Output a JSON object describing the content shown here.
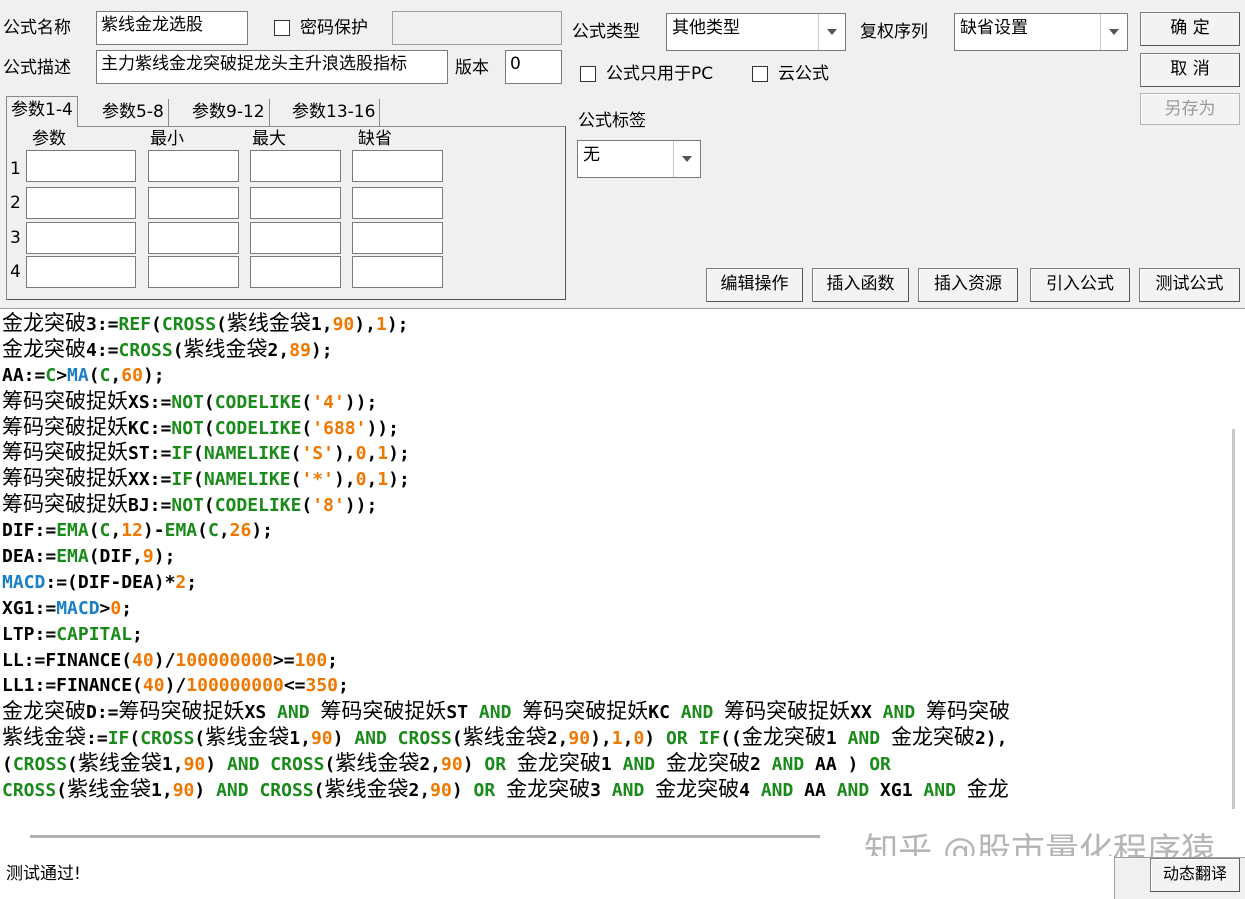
{
  "form": {
    "name_label": "公式名称",
    "name_value": "紫线金龙选股",
    "password_label": "密码保护",
    "desc_label": "公式描述",
    "desc_value": "主力紫线金龙突破捉龙头主升浪选股指标",
    "version_label": "版本",
    "version_value": "0",
    "type_label": "公式类型",
    "type_value": "其他类型",
    "rights_label": "复权序列",
    "rights_value": "缺省设置",
    "pc_only_label": "公式只用于PC",
    "cloud_label": "云公式",
    "tag_label": "公式标签",
    "tag_value": "无"
  },
  "buttons": {
    "ok": "确  定",
    "cancel": "取  消",
    "save_as": "另存为",
    "edit_ops": "编辑操作",
    "insert_func": "插入函数",
    "insert_res": "插入资源",
    "import_formula": "引入公式",
    "test_formula": "测试公式",
    "dynamic_translate": "动态翻译"
  },
  "tabs": [
    "参数1-4",
    "参数5-8",
    "参数9-12",
    "参数13-16"
  ],
  "params": {
    "headers": [
      "参数",
      "最小",
      "最大",
      "缺省"
    ],
    "rows": [
      "1",
      "2",
      "3",
      "4"
    ]
  },
  "code_lines": [
    [
      [
        "cn",
        "金龙突破"
      ],
      [
        "t",
        "3:="
      ],
      [
        "kw",
        "REF"
      ],
      [
        "t",
        "("
      ],
      [
        "kw",
        "CROSS"
      ],
      [
        "t",
        "("
      ],
      [
        "cn",
        "紫线金袋"
      ],
      [
        "t",
        "1,"
      ],
      [
        "num",
        "90"
      ],
      [
        "t",
        "),"
      ],
      [
        "num",
        "1"
      ],
      [
        "t",
        ");"
      ]
    ],
    [
      [
        "cn",
        "金龙突破"
      ],
      [
        "t",
        "4:="
      ],
      [
        "kw",
        "CROSS"
      ],
      [
        "t",
        "("
      ],
      [
        "cn",
        "紫线金袋"
      ],
      [
        "t",
        "2,"
      ],
      [
        "num",
        "89"
      ],
      [
        "t",
        ");"
      ]
    ],
    [
      [
        "t",
        "AA:="
      ],
      [
        "kw",
        "C"
      ],
      [
        "t",
        ">"
      ],
      [
        "id",
        "MA"
      ],
      [
        "t",
        "("
      ],
      [
        "kw",
        "C"
      ],
      [
        "t",
        ","
      ],
      [
        "num",
        "60"
      ],
      [
        "t",
        ");"
      ]
    ],
    [
      [
        "cn",
        "筹码突破捉妖"
      ],
      [
        "t",
        "XS:="
      ],
      [
        "kw",
        "NOT"
      ],
      [
        "t",
        "("
      ],
      [
        "kw",
        "CODELIKE"
      ],
      [
        "t",
        "("
      ],
      [
        "str",
        "'4'"
      ],
      [
        "t",
        "));"
      ]
    ],
    [
      [
        "cn",
        "筹码突破捉妖"
      ],
      [
        "t",
        "KC:="
      ],
      [
        "kw",
        "NOT"
      ],
      [
        "t",
        "("
      ],
      [
        "kw",
        "CODELIKE"
      ],
      [
        "t",
        "("
      ],
      [
        "str",
        "'688'"
      ],
      [
        "t",
        "));"
      ]
    ],
    [
      [
        "cn",
        "筹码突破捉妖"
      ],
      [
        "t",
        "ST:="
      ],
      [
        "kw",
        "IF"
      ],
      [
        "t",
        "("
      ],
      [
        "kw",
        "NAMELIKE"
      ],
      [
        "t",
        "("
      ],
      [
        "str",
        "'S'"
      ],
      [
        "t",
        "),"
      ],
      [
        "num",
        "0"
      ],
      [
        "t",
        ","
      ],
      [
        "num",
        "1"
      ],
      [
        "t",
        ");"
      ]
    ],
    [
      [
        "cn",
        "筹码突破捉妖"
      ],
      [
        "t",
        "XX:="
      ],
      [
        "kw",
        "IF"
      ],
      [
        "t",
        "("
      ],
      [
        "kw",
        "NAMELIKE"
      ],
      [
        "t",
        "("
      ],
      [
        "str",
        "'*'"
      ],
      [
        "t",
        "),"
      ],
      [
        "num",
        "0"
      ],
      [
        "t",
        ","
      ],
      [
        "num",
        "1"
      ],
      [
        "t",
        ");"
      ]
    ],
    [
      [
        "cn",
        "筹码突破捉妖"
      ],
      [
        "t",
        "BJ:="
      ],
      [
        "kw",
        "NOT"
      ],
      [
        "t",
        "("
      ],
      [
        "kw",
        "CODELIKE"
      ],
      [
        "t",
        "("
      ],
      [
        "str",
        "'8'"
      ],
      [
        "t",
        "));"
      ]
    ],
    [
      [
        "t",
        "DIF:="
      ],
      [
        "kw",
        "EMA"
      ],
      [
        "t",
        "("
      ],
      [
        "kw",
        "C"
      ],
      [
        "t",
        ","
      ],
      [
        "num",
        "12"
      ],
      [
        "t",
        ")-"
      ],
      [
        "kw",
        "EMA"
      ],
      [
        "t",
        "("
      ],
      [
        "kw",
        "C"
      ],
      [
        "t",
        ","
      ],
      [
        "num",
        "26"
      ],
      [
        "t",
        ");"
      ]
    ],
    [
      [
        "t",
        "DEA:="
      ],
      [
        "kw",
        "EMA"
      ],
      [
        "t",
        "(DIF,"
      ],
      [
        "num",
        "9"
      ],
      [
        "t",
        ");"
      ]
    ],
    [
      [
        "id",
        "MACD"
      ],
      [
        "t",
        ":=(DIF-DEA)*"
      ],
      [
        "num",
        "2"
      ],
      [
        "t",
        ";"
      ]
    ],
    [
      [
        "t",
        "XG1:="
      ],
      [
        "id",
        "MACD"
      ],
      [
        "t",
        ">"
      ],
      [
        "num",
        "0"
      ],
      [
        "t",
        ";"
      ]
    ],
    [
      [
        "t",
        "LTP:="
      ],
      [
        "kw",
        "CAPITAL"
      ],
      [
        "t",
        ";"
      ]
    ],
    [
      [
        "t",
        "LL:=FINANCE("
      ],
      [
        "num",
        "40"
      ],
      [
        "t",
        ")/"
      ],
      [
        "num",
        "100000000"
      ],
      [
        "t",
        ">="
      ],
      [
        "num",
        "100"
      ],
      [
        "t",
        ";"
      ]
    ],
    [
      [
        "t",
        "LL1:=FINANCE("
      ],
      [
        "num",
        "40"
      ],
      [
        "t",
        ")/"
      ],
      [
        "num",
        "100000000"
      ],
      [
        "t",
        "<="
      ],
      [
        "num",
        "350"
      ],
      [
        "t",
        ";"
      ]
    ],
    [
      [
        "cn",
        "金龙突破"
      ],
      [
        "t",
        "D:="
      ],
      [
        "cn",
        "筹码突破捉妖"
      ],
      [
        "t",
        "XS "
      ],
      [
        "kw",
        "AND"
      ],
      [
        "t",
        " "
      ],
      [
        "cn",
        "筹码突破捉妖"
      ],
      [
        "t",
        "ST "
      ],
      [
        "kw",
        "AND"
      ],
      [
        "t",
        " "
      ],
      [
        "cn",
        "筹码突破捉妖"
      ],
      [
        "t",
        "KC "
      ],
      [
        "kw",
        "AND"
      ],
      [
        "t",
        " "
      ],
      [
        "cn",
        "筹码突破捉妖"
      ],
      [
        "t",
        "XX "
      ],
      [
        "kw",
        "AND"
      ],
      [
        "t",
        " "
      ],
      [
        "cn",
        "筹码突破"
      ]
    ],
    [
      [
        "cn",
        "紫线金袋"
      ],
      [
        "t",
        ":="
      ],
      [
        "kw",
        "IF"
      ],
      [
        "t",
        "("
      ],
      [
        "kw",
        "CROSS"
      ],
      [
        "t",
        "("
      ],
      [
        "cn",
        "紫线金袋"
      ],
      [
        "t",
        "1,"
      ],
      [
        "num",
        "90"
      ],
      [
        "t",
        ") "
      ],
      [
        "kw",
        "AND"
      ],
      [
        "t",
        " "
      ],
      [
        "kw",
        "CROSS"
      ],
      [
        "t",
        "("
      ],
      [
        "cn",
        "紫线金袋"
      ],
      [
        "t",
        "2,"
      ],
      [
        "num",
        "90"
      ],
      [
        "t",
        "),"
      ],
      [
        "num",
        "1"
      ],
      [
        "t",
        ","
      ],
      [
        "num",
        "0"
      ],
      [
        "t",
        ") "
      ],
      [
        "kw",
        "OR"
      ],
      [
        "t",
        " "
      ],
      [
        "kw",
        "IF"
      ],
      [
        "t",
        "(("
      ],
      [
        "cn",
        "金龙突破"
      ],
      [
        "t",
        "1 "
      ],
      [
        "kw",
        "AND"
      ],
      [
        "t",
        " "
      ],
      [
        "cn",
        "金龙突破"
      ],
      [
        "t",
        "2),"
      ]
    ],
    [
      [
        "t",
        "("
      ],
      [
        "kw",
        "CROSS"
      ],
      [
        "t",
        "("
      ],
      [
        "cn",
        "紫线金袋"
      ],
      [
        "t",
        "1,"
      ],
      [
        "num",
        "90"
      ],
      [
        "t",
        ") "
      ],
      [
        "kw",
        "AND"
      ],
      [
        "t",
        " "
      ],
      [
        "kw",
        "CROSS"
      ],
      [
        "t",
        "("
      ],
      [
        "cn",
        "紫线金袋"
      ],
      [
        "t",
        "2,"
      ],
      [
        "num",
        "90"
      ],
      [
        "t",
        ") "
      ],
      [
        "kw",
        "OR"
      ],
      [
        "t",
        " "
      ],
      [
        "cn",
        "金龙突破"
      ],
      [
        "t",
        "1 "
      ],
      [
        "kw",
        "AND"
      ],
      [
        "t",
        " "
      ],
      [
        "cn",
        "金龙突破"
      ],
      [
        "t",
        "2 "
      ],
      [
        "kw",
        "AND"
      ],
      [
        "t",
        " AA ) "
      ],
      [
        "kw",
        "OR"
      ]
    ],
    [
      [
        "kw",
        "CROSS"
      ],
      [
        "t",
        "("
      ],
      [
        "cn",
        "紫线金袋"
      ],
      [
        "t",
        "1,"
      ],
      [
        "num",
        "90"
      ],
      [
        "t",
        ") "
      ],
      [
        "kw",
        "AND"
      ],
      [
        "t",
        " "
      ],
      [
        "kw",
        "CROSS"
      ],
      [
        "t",
        "("
      ],
      [
        "cn",
        "紫线金袋"
      ],
      [
        "t",
        "2,"
      ],
      [
        "num",
        "90"
      ],
      [
        "t",
        ") "
      ],
      [
        "kw",
        "OR"
      ],
      [
        "t",
        " "
      ],
      [
        "cn",
        "金龙突破"
      ],
      [
        "t",
        "3 "
      ],
      [
        "kw",
        "AND"
      ],
      [
        "t",
        " "
      ],
      [
        "cn",
        "金龙突破"
      ],
      [
        "t",
        "4 "
      ],
      [
        "kw",
        "AND"
      ],
      [
        "t",
        " AA "
      ],
      [
        "kw",
        "AND"
      ],
      [
        "t",
        " XG1 "
      ],
      [
        "kw",
        "AND"
      ],
      [
        "t",
        " "
      ],
      [
        "cn",
        "金龙"
      ]
    ]
  ],
  "watermark": "知乎 @股市量化程序猿",
  "status": "测试通过!"
}
